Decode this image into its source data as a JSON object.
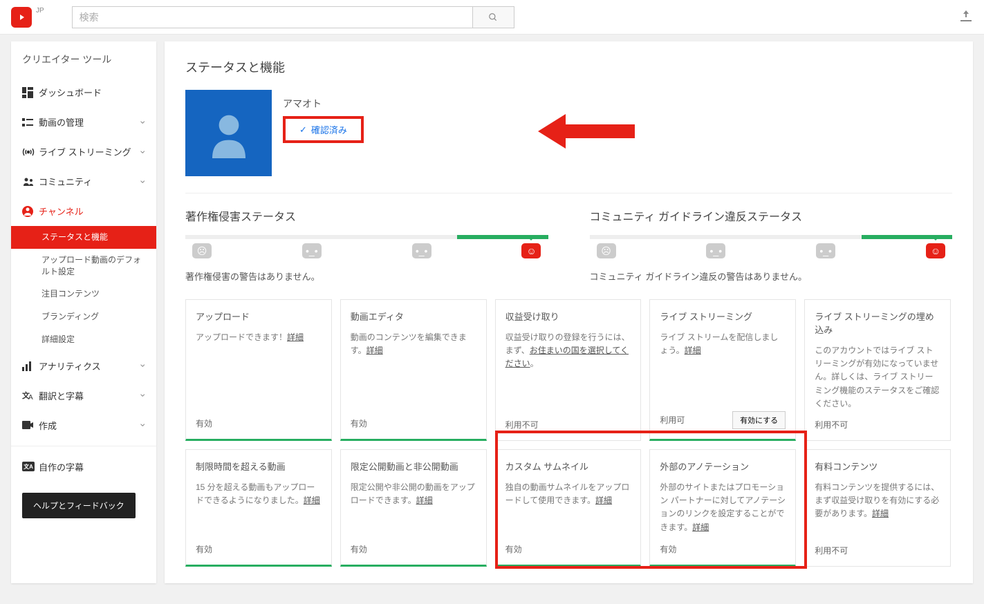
{
  "topbar": {
    "region": "JP",
    "search_placeholder": "検索"
  },
  "sidebar": {
    "title": "クリエイター ツール",
    "items": [
      {
        "label": "ダッシュボード",
        "icon": "dashboard"
      },
      {
        "label": "動画の管理",
        "icon": "video",
        "chev": true
      },
      {
        "label": "ライブ ストリーミング",
        "icon": "live",
        "chev": true
      },
      {
        "label": "コミュニティ",
        "icon": "community",
        "chev": true
      },
      {
        "label": "チャンネル",
        "icon": "channel",
        "active": true
      }
    ],
    "subitems": [
      {
        "label": "ステータスと機能",
        "selected": true
      },
      {
        "label": "アップロード動画のデフォルト設定"
      },
      {
        "label": "注目コンテンツ"
      },
      {
        "label": "ブランディング"
      },
      {
        "label": "詳細設定"
      }
    ],
    "items2": [
      {
        "label": "アナリティクス",
        "icon": "analytics",
        "chev": true
      },
      {
        "label": "翻訳と字幕",
        "icon": "translate",
        "chev": true
      },
      {
        "label": "作成",
        "icon": "create",
        "chev": true
      }
    ],
    "subtitles_item": {
      "label": "自作の字幕",
      "icon": "cc"
    },
    "feedback": "ヘルプとフィードバック"
  },
  "main": {
    "title": "ステータスと機能",
    "channel_name": "アマオト",
    "verified": "確認済み",
    "copyright": {
      "title": "著作権侵害ステータス",
      "msg": "著作権侵害の警告はありません。"
    },
    "community": {
      "title": "コミュニティ ガイドライン違反ステータス",
      "msg": "コミュニティ ガイドライン違反の警告はありません。"
    },
    "cards": [
      {
        "title": "アップロード",
        "desc": "アップロードできます！",
        "link": "詳細",
        "status": "有効",
        "green": true
      },
      {
        "title": "動画エディタ",
        "desc": "動画のコンテンツを編集できます。",
        "link": "詳細",
        "status": "有効",
        "green": true
      },
      {
        "title": "収益受け取り",
        "desc": "収益受け取りの登録を行うには、まず、",
        "link": "お住まいの国を選択してください",
        "suffix": "。",
        "status": "利用不可"
      },
      {
        "title": "ライブ ストリーミング",
        "desc": "ライブ ストリームを配信しましょう。",
        "link": "詳細",
        "status": "利用可",
        "btn": "有効にする",
        "green": true
      },
      {
        "title": "ライブ ストリーミングの埋め込み",
        "desc": "このアカウントではライブ ストリーミングが有効になっていません。詳しくは、ライブ ストリーミング機能のステータスをご確認ください。",
        "status": "利用不可"
      },
      {
        "title": "制限時間を超える動画",
        "desc": "15 分を超える動画もアップロードできるようになりました。",
        "link": "詳細",
        "status": "有効",
        "green": true
      },
      {
        "title": "限定公開動画と非公開動画",
        "desc": "限定公開や非公開の動画をアップロードできます。",
        "link": "詳細",
        "status": "有効",
        "green": true
      },
      {
        "title": "カスタム サムネイル",
        "desc": "独自の動画サムネイルをアップロードして使用できます。",
        "link": "詳細",
        "status": "有効",
        "green": true
      },
      {
        "title": "外部のアノテーション",
        "desc": "外部のサイトまたはプロモーション パートナーに対してアノテーションのリンクを設定することができます。",
        "link": "詳細",
        "status": "有効",
        "green": true
      },
      {
        "title": "有料コンテンツ",
        "desc": "有料コンテンツを提供するには、まず収益受け取りを有効にする必要があります。",
        "link": "詳細",
        "status": "利用不可"
      }
    ]
  }
}
